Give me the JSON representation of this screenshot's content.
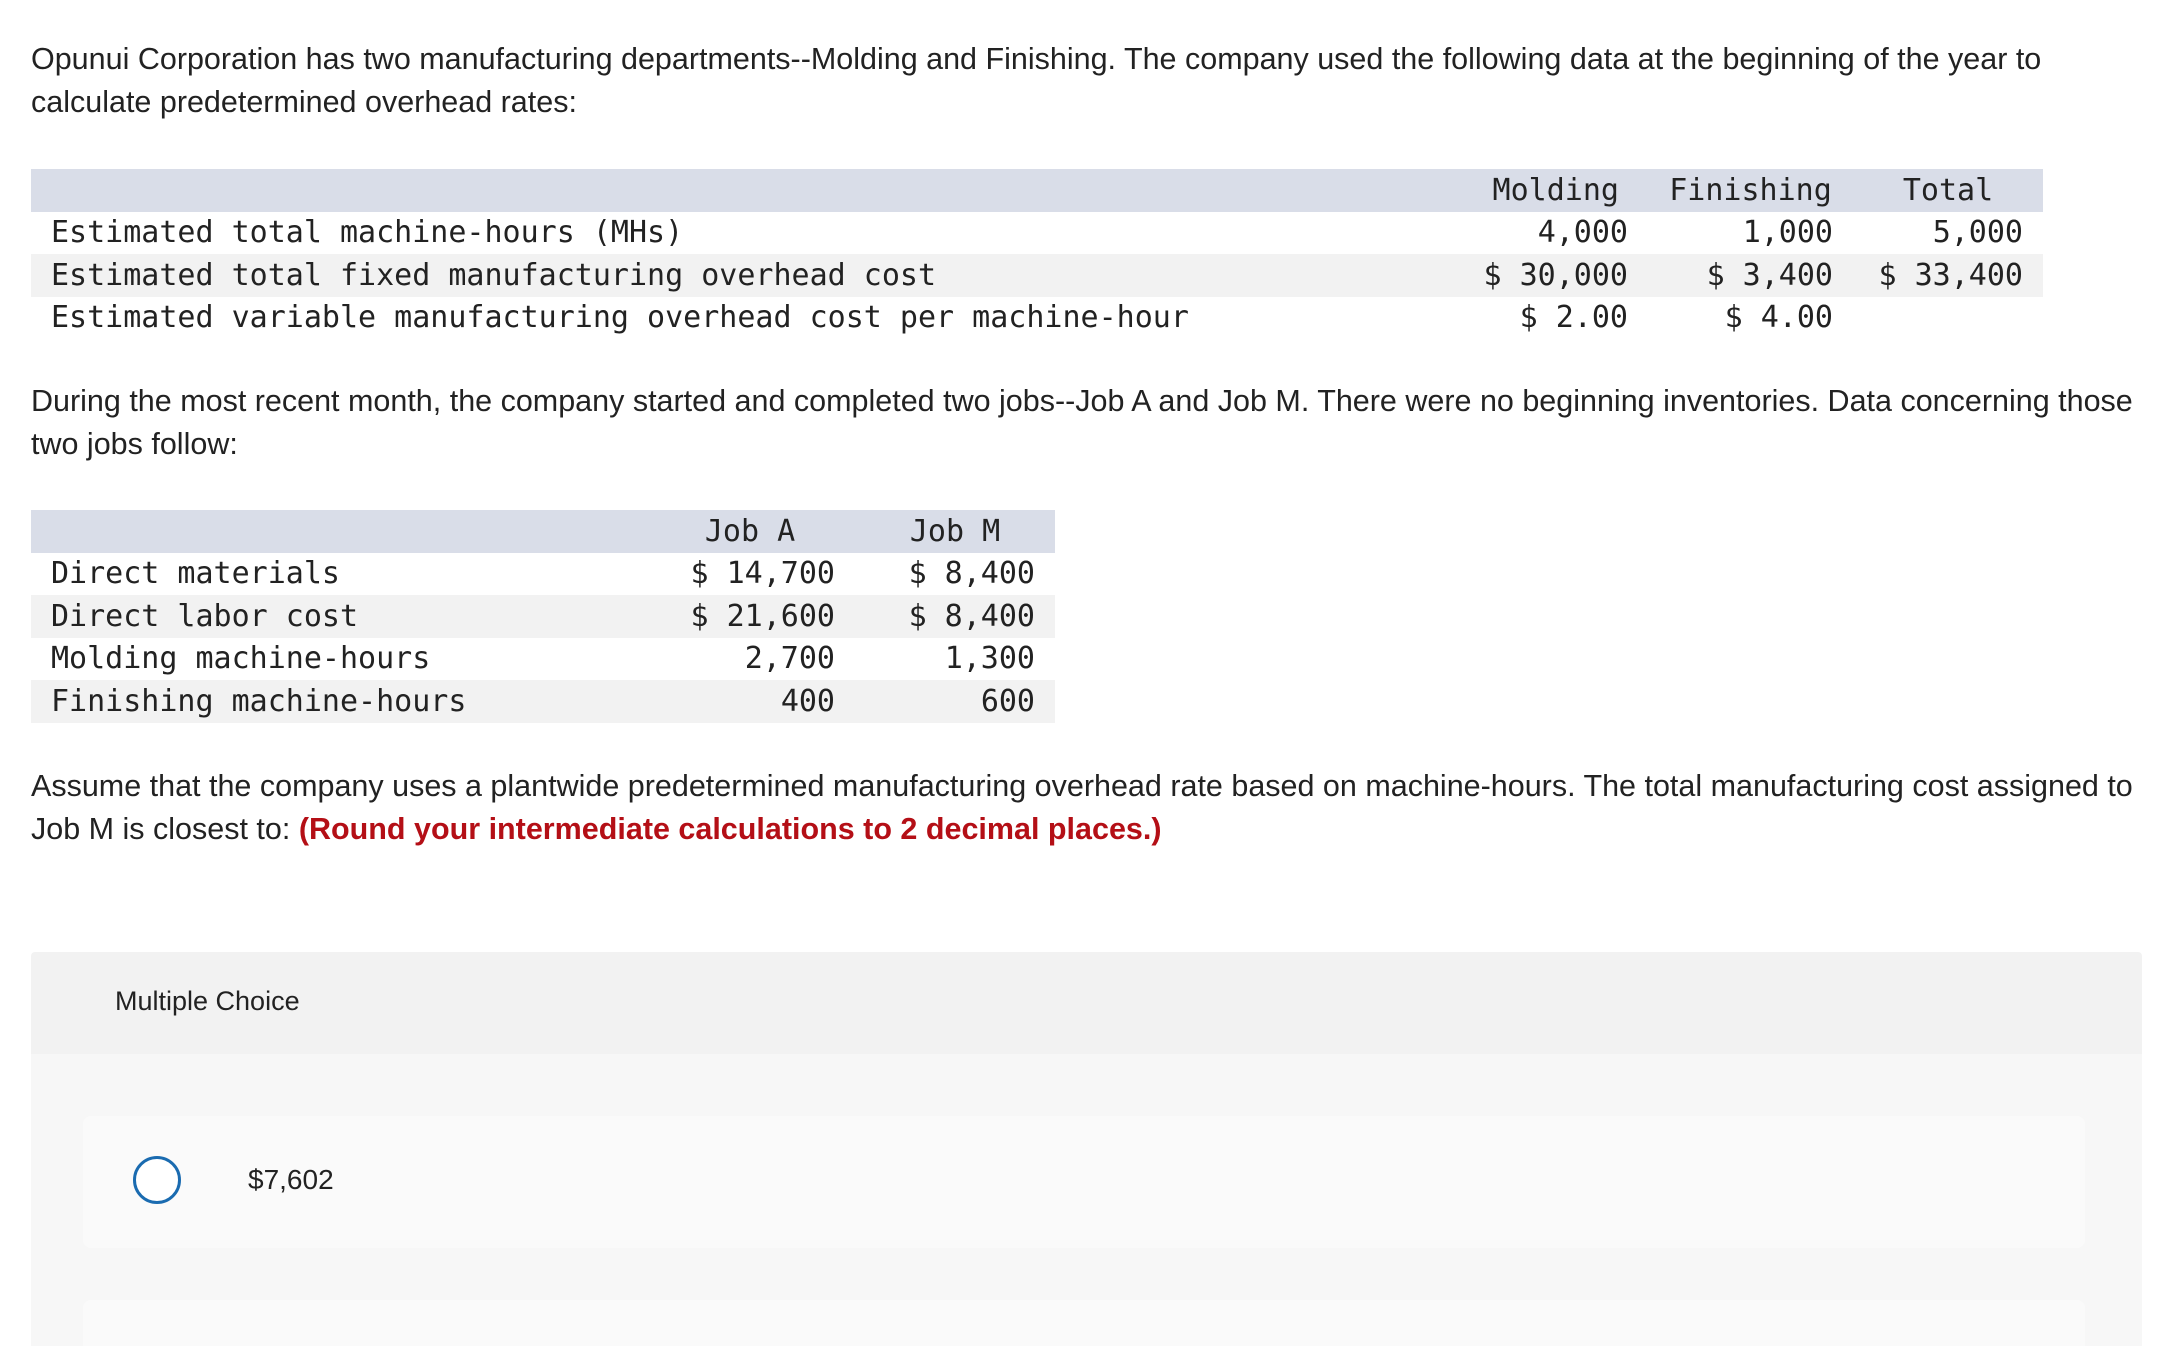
{
  "intro_text": "Opunui Corporation has two manufacturing departments--Molding and Finishing. The company used the following data at the beginning of the year to calculate predetermined overhead rates:",
  "dept_table": {
    "headers": [
      "",
      "Molding",
      "Finishing",
      "Total"
    ],
    "rows": [
      {
        "label": "Estimated total machine-hours (MHs)",
        "molding": "4,000",
        "finishing": "1,000",
        "total": "5,000"
      },
      {
        "label": "Estimated total fixed manufacturing overhead cost",
        "molding": "$ 30,000",
        "finishing": "$ 3,400",
        "total": "$ 33,400"
      },
      {
        "label": "Estimated variable manufacturing overhead cost per machine-hour",
        "molding": "$ 2.00",
        "finishing": "$ 4.00",
        "total": ""
      }
    ]
  },
  "jobs_text": "During the most recent month, the company started and completed two jobs--Job A and Job M. There were no beginning inventories. Data concerning those two jobs follow:",
  "job_table": {
    "headers": [
      "",
      "Job A",
      "Job M"
    ],
    "rows": [
      {
        "label": "Direct materials",
        "job_a": "$ 14,700",
        "job_m": "$ 8,400"
      },
      {
        "label": "Direct labor cost",
        "job_a": "$ 21,600",
        "job_m": "$ 8,400"
      },
      {
        "label": "Molding machine-hours",
        "job_a": "2,700",
        "job_m": "1,300"
      },
      {
        "label": "Finishing machine-hours",
        "job_a": "400",
        "job_m": "600"
      }
    ]
  },
  "question_text": "Assume that the company uses a plantwide predetermined manufacturing overhead rate based on machine-hours. The total manufacturing cost assigned to Job M is closest to: ",
  "question_emphasis": "(Round your intermediate calculations to 2 decimal places.)",
  "multiple_choice": {
    "header": "Multiple Choice",
    "options": [
      {
        "label": "$7,602"
      }
    ]
  },
  "colors": {
    "table_header_bg": "#d9dde8",
    "row_shade": "#f2f2f2",
    "emphasis": "#b40f16",
    "radio_border": "#1a6bb0"
  }
}
